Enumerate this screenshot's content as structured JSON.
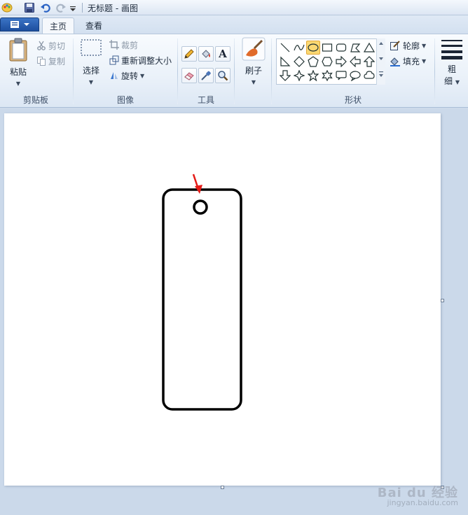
{
  "window": {
    "title": "无标题 - 画图"
  },
  "tabs": [
    {
      "label": "主页",
      "active": true
    },
    {
      "label": "查看",
      "active": false
    }
  ],
  "clipboard": {
    "paste_label": "粘贴",
    "cut_label": "剪切",
    "copy_label": "复制",
    "group_label": "剪贴板"
  },
  "image": {
    "select_label": "选择",
    "crop_label": "裁剪",
    "resize_label": "重新调整大小",
    "rotate_label": "旋转",
    "group_label": "图像"
  },
  "tools": {
    "group_label": "工具",
    "text_tool_glyph": "A"
  },
  "brushes": {
    "label": "刷子"
  },
  "shapes": {
    "group_label": "形状",
    "outline_label": "轮廓",
    "fill_label": "填充",
    "selected_shape": "oval"
  },
  "size": {
    "label_top": "粗",
    "label_bottom": "细"
  },
  "watermark": {
    "logo_text": "Bai du 经验",
    "url_text": "jingyan.baidu.com"
  },
  "colors": {
    "accent": "#e41b17",
    "ribbon_bg": "#eaf1f9",
    "workspace_bg": "#cbd9ea"
  },
  "icons": [
    "paint-app-icon",
    "save-icon",
    "undo-icon",
    "redo-icon",
    "qat-dropdown-icon",
    "file-menu-icon",
    "paste-icon",
    "scissors-icon",
    "copy-icon",
    "select-icon",
    "crop-icon",
    "resize-icon",
    "rotate-icon",
    "pencil-icon",
    "fill-bucket-icon",
    "text-icon",
    "eraser-icon",
    "color-picker-icon",
    "magnifier-icon",
    "brush-icon",
    "outline-icon",
    "fill-icon",
    "size-icon"
  ]
}
